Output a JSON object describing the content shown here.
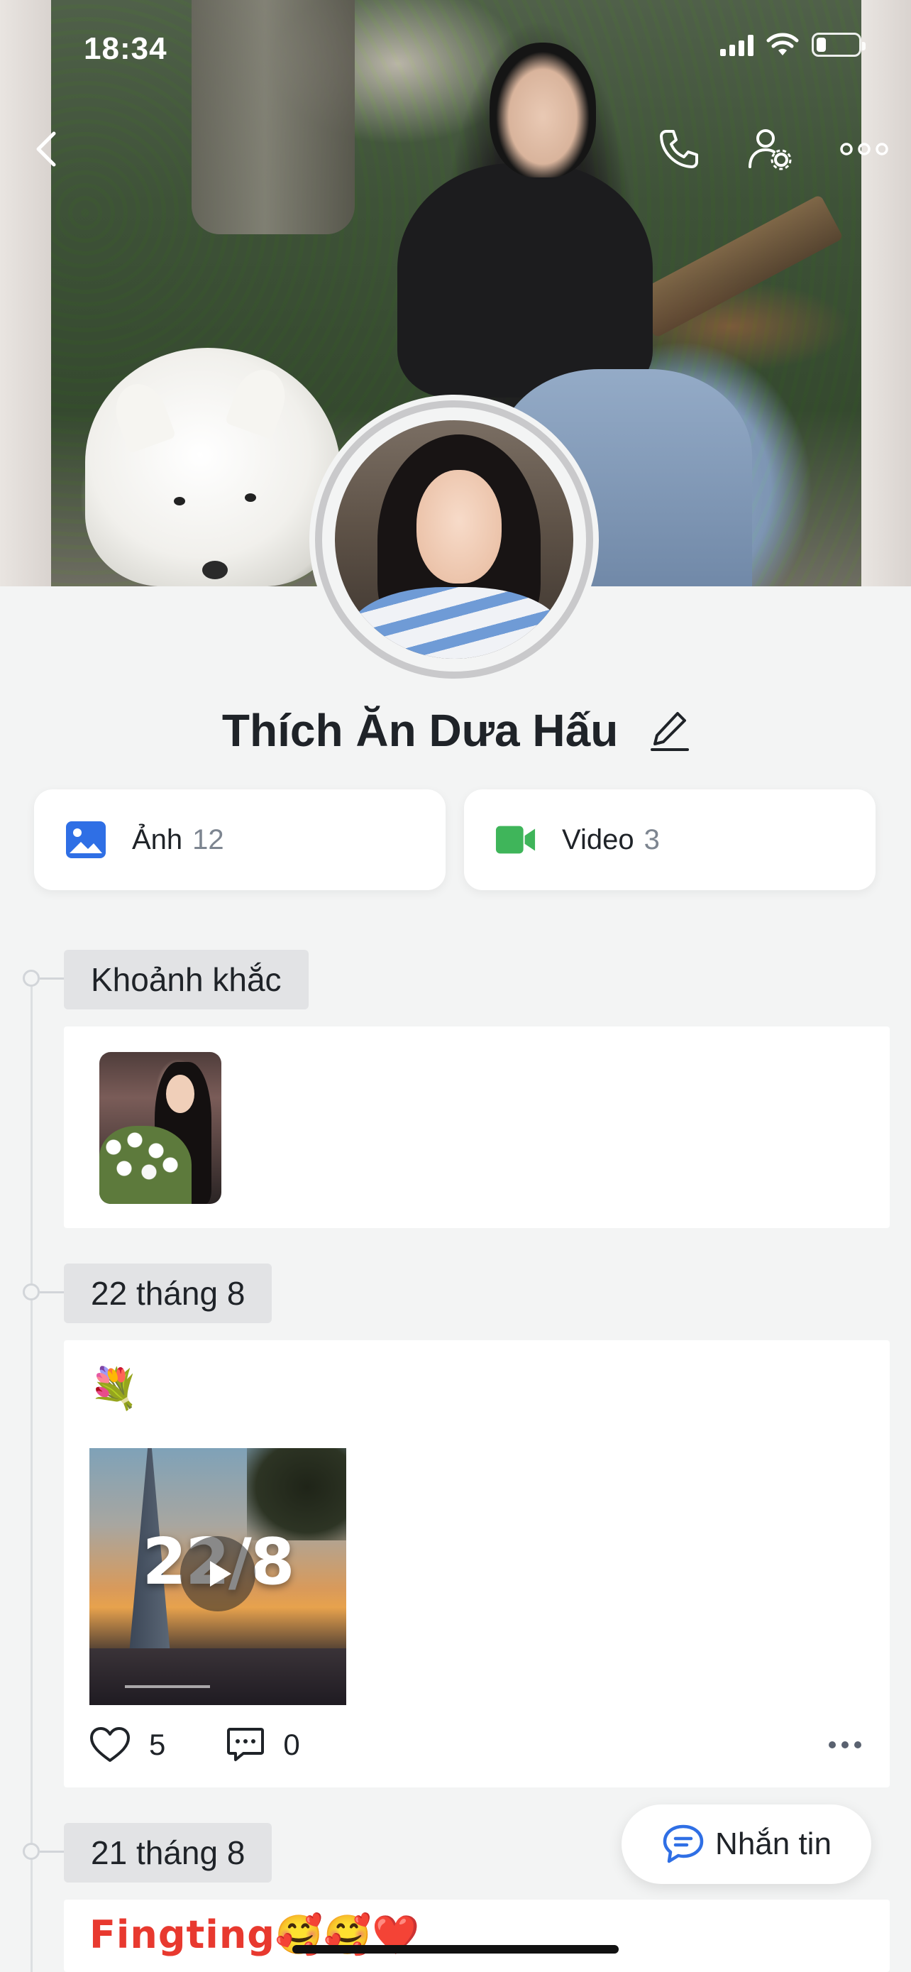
{
  "status_bar": {
    "time": "18:34",
    "battery_level": 0.24
  },
  "profile": {
    "name": "Thích Ăn Dưa Hấu"
  },
  "media": {
    "photos": {
      "label": "Ảnh",
      "count": "12",
      "icon": "image-icon",
      "color": "#2f6fe5"
    },
    "videos": {
      "label": "Video",
      "count": "3",
      "icon": "video-camera-icon",
      "color": "#3fb55a"
    }
  },
  "timeline": {
    "moments_label": "Khoảnh khắc",
    "posts": [
      {
        "date": "22 tháng 8",
        "emoji": "💐",
        "video_overlay_text": "22/8",
        "likes": "5",
        "comments": "0"
      },
      {
        "date": "21 tháng 8",
        "text": "Fingting🥰🥰❤️"
      }
    ]
  },
  "actions": {
    "message_label": "Nhắn tin"
  },
  "colors": {
    "accent_blue": "#2f6fe5",
    "video_green": "#3fb55a",
    "page_bg": "#f3f4f4",
    "post_title_red": "#e8392f"
  }
}
